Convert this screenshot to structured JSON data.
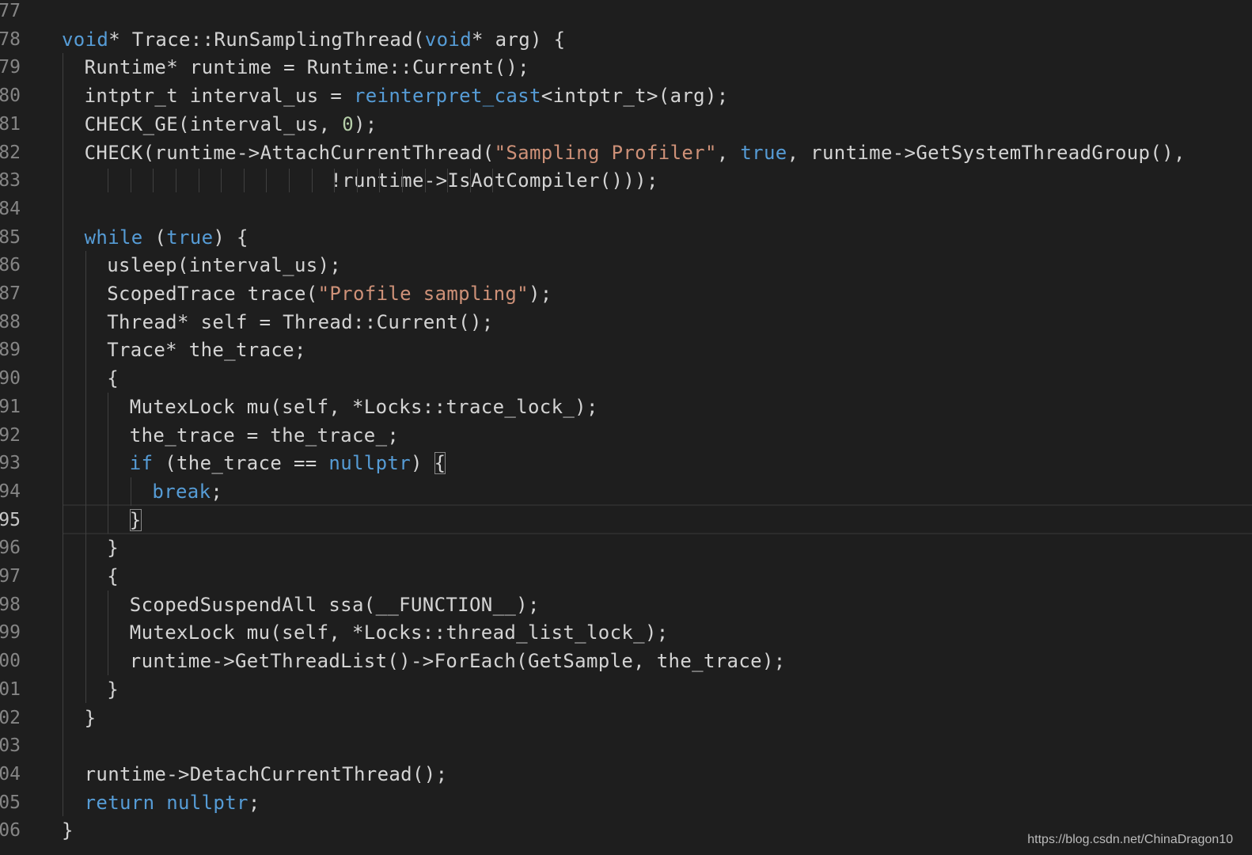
{
  "editor": {
    "current_line": "95",
    "lines": [
      {
        "n": "77",
        "indent": 0,
        "tokens": []
      },
      {
        "n": "78",
        "indent": 0,
        "tokens": [
          [
            "kw",
            "void"
          ],
          [
            "p",
            "* Trace::RunSamplingThread("
          ],
          [
            "kw",
            "void"
          ],
          [
            "p",
            "* arg) {"
          ]
        ]
      },
      {
        "n": "79",
        "indent": 1,
        "tokens": [
          [
            "p",
            "Runtime* runtime = Runtime::Current();"
          ]
        ]
      },
      {
        "n": "80",
        "indent": 1,
        "tokens": [
          [
            "p",
            "intptr_t interval_us = "
          ],
          [
            "kw",
            "reinterpret_cast"
          ],
          [
            "p",
            "<intptr_t>(arg);"
          ]
        ]
      },
      {
        "n": "81",
        "indent": 1,
        "tokens": [
          [
            "p",
            "CHECK_GE(interval_us, "
          ],
          [
            "num",
            "0"
          ],
          [
            "p",
            ");"
          ]
        ]
      },
      {
        "n": "82",
        "indent": 1,
        "tokens": [
          [
            "p",
            "CHECK(runtime->AttachCurrentThread("
          ],
          [
            "str",
            "\"Sampling Profiler\""
          ],
          [
            "p",
            ", "
          ],
          [
            "kw",
            "true"
          ],
          [
            "p",
            ", runtime->GetSystemThreadGroup(),"
          ]
        ]
      },
      {
        "n": "83",
        "indent": 1,
        "tokens": [
          [
            "p",
            "                     !runtime->IsAotCompiler()));"
          ]
        ]
      },
      {
        "n": "84",
        "indent": 0,
        "tokens": []
      },
      {
        "n": "85",
        "indent": 1,
        "tokens": [
          [
            "kw",
            "while"
          ],
          [
            "p",
            " ("
          ],
          [
            "kw",
            "true"
          ],
          [
            "p",
            ") {"
          ]
        ]
      },
      {
        "n": "86",
        "indent": 2,
        "tokens": [
          [
            "p",
            "usleep(interval_us);"
          ]
        ]
      },
      {
        "n": "87",
        "indent": 2,
        "tokens": [
          [
            "p",
            "ScopedTrace trace("
          ],
          [
            "str",
            "\"Profile sampling\""
          ],
          [
            "p",
            ");"
          ]
        ]
      },
      {
        "n": "88",
        "indent": 2,
        "tokens": [
          [
            "p",
            "Thread* self = Thread::Current();"
          ]
        ]
      },
      {
        "n": "89",
        "indent": 2,
        "tokens": [
          [
            "p",
            "Trace* the_trace;"
          ]
        ]
      },
      {
        "n": "90",
        "indent": 2,
        "tokens": [
          [
            "p",
            "{"
          ]
        ]
      },
      {
        "n": "91",
        "indent": 3,
        "tokens": [
          [
            "p",
            "MutexLock mu(self, *Locks::trace_lock_);"
          ]
        ]
      },
      {
        "n": "92",
        "indent": 3,
        "tokens": [
          [
            "p",
            "the_trace = the_trace_;"
          ]
        ]
      },
      {
        "n": "93",
        "indent": 3,
        "tokens": [
          [
            "kw",
            "if"
          ],
          [
            "p",
            " (the_trace == "
          ],
          [
            "kw",
            "nullptr"
          ],
          [
            "p",
            ") "
          ],
          [
            "match",
            "{"
          ]
        ]
      },
      {
        "n": "94",
        "indent": 4,
        "tokens": [
          [
            "kw",
            "break"
          ],
          [
            "p",
            ";"
          ]
        ]
      },
      {
        "n": "95",
        "indent": 3,
        "tokens": [
          [
            "match",
            "}"
          ]
        ]
      },
      {
        "n": "96",
        "indent": 2,
        "tokens": [
          [
            "p",
            "}"
          ]
        ]
      },
      {
        "n": "97",
        "indent": 2,
        "tokens": [
          [
            "p",
            "{"
          ]
        ]
      },
      {
        "n": "98",
        "indent": 3,
        "tokens": [
          [
            "p",
            "ScopedSuspendAll ssa(__FUNCTION__);"
          ]
        ]
      },
      {
        "n": "99",
        "indent": 3,
        "tokens": [
          [
            "p",
            "MutexLock mu(self, *Locks::thread_list_lock_);"
          ]
        ]
      },
      {
        "n": "00",
        "indent": 3,
        "tokens": [
          [
            "p",
            "runtime->GetThreadList()->ForEach(GetSample, the_trace);"
          ]
        ]
      },
      {
        "n": "01",
        "indent": 2,
        "tokens": [
          [
            "p",
            "}"
          ]
        ]
      },
      {
        "n": "02",
        "indent": 1,
        "tokens": [
          [
            "p",
            "}"
          ]
        ]
      },
      {
        "n": "03",
        "indent": 0,
        "tokens": []
      },
      {
        "n": "04",
        "indent": 1,
        "tokens": [
          [
            "p",
            "runtime->DetachCurrentThread();"
          ]
        ]
      },
      {
        "n": "05",
        "indent": 1,
        "tokens": [
          [
            "kw",
            "return"
          ],
          [
            "p",
            " "
          ],
          [
            "kw",
            "nullptr"
          ],
          [
            "p",
            ";"
          ]
        ]
      },
      {
        "n": "06",
        "indent": 0,
        "tokens": [
          [
            "p",
            "}"
          ]
        ]
      }
    ]
  },
  "watermark": "https://blog.csdn.net/ChinaDragon10",
  "colors": {
    "background": "#1e1e1e",
    "text": "#d4d4d4",
    "keyword": "#569cd6",
    "string": "#ce9178",
    "number": "#b5cea8",
    "line_number": "#858585"
  }
}
